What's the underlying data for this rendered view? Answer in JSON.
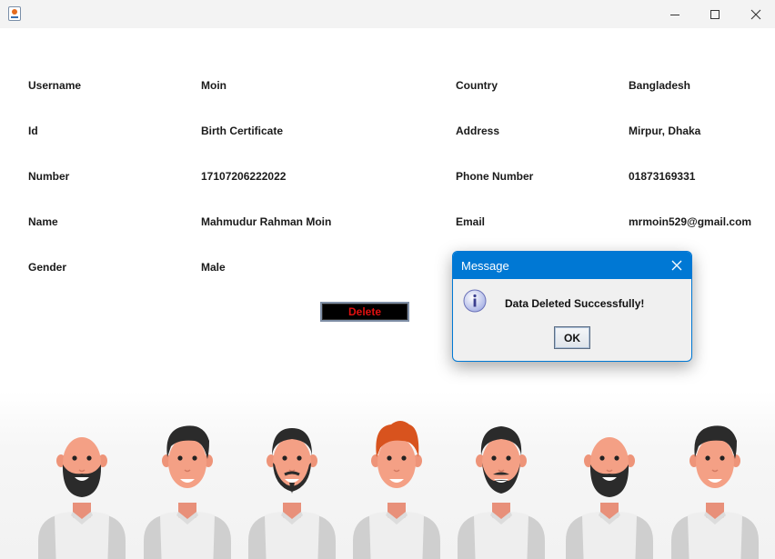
{
  "window": {
    "controls": {
      "minimize": "minimize-icon",
      "maximize": "maximize-icon",
      "close": "close-icon"
    }
  },
  "form": {
    "username": {
      "label": "Username",
      "value": "Moin"
    },
    "id": {
      "label": "Id",
      "value": "Birth Certificate"
    },
    "number": {
      "label": "Number",
      "value": "17107206222022"
    },
    "name": {
      "label": "Name",
      "value": "Mahmudur Rahman Moin"
    },
    "gender": {
      "label": "Gender",
      "value": "Male"
    },
    "country": {
      "label": "Country",
      "value": "Bangladesh"
    },
    "address": {
      "label": "Address",
      "value": "Mirpur, Dhaka"
    },
    "phone": {
      "label": "Phone Number",
      "value": "01873169331"
    },
    "email": {
      "label": "Email",
      "value": "mrmoin529@gmail.com"
    }
  },
  "actions": {
    "delete_label": "Delete"
  },
  "dialog": {
    "title": "Message",
    "message": "Data Deleted Successfully!",
    "ok_label": "OK",
    "icon": "info-icon"
  },
  "colors": {
    "title_bar": "#f3f3f3",
    "dialog_accent": "#0078d4",
    "delete_bg": "#000000",
    "delete_text": "#e01010"
  },
  "illustration": {
    "name": "people-illustration",
    "count": 7
  }
}
